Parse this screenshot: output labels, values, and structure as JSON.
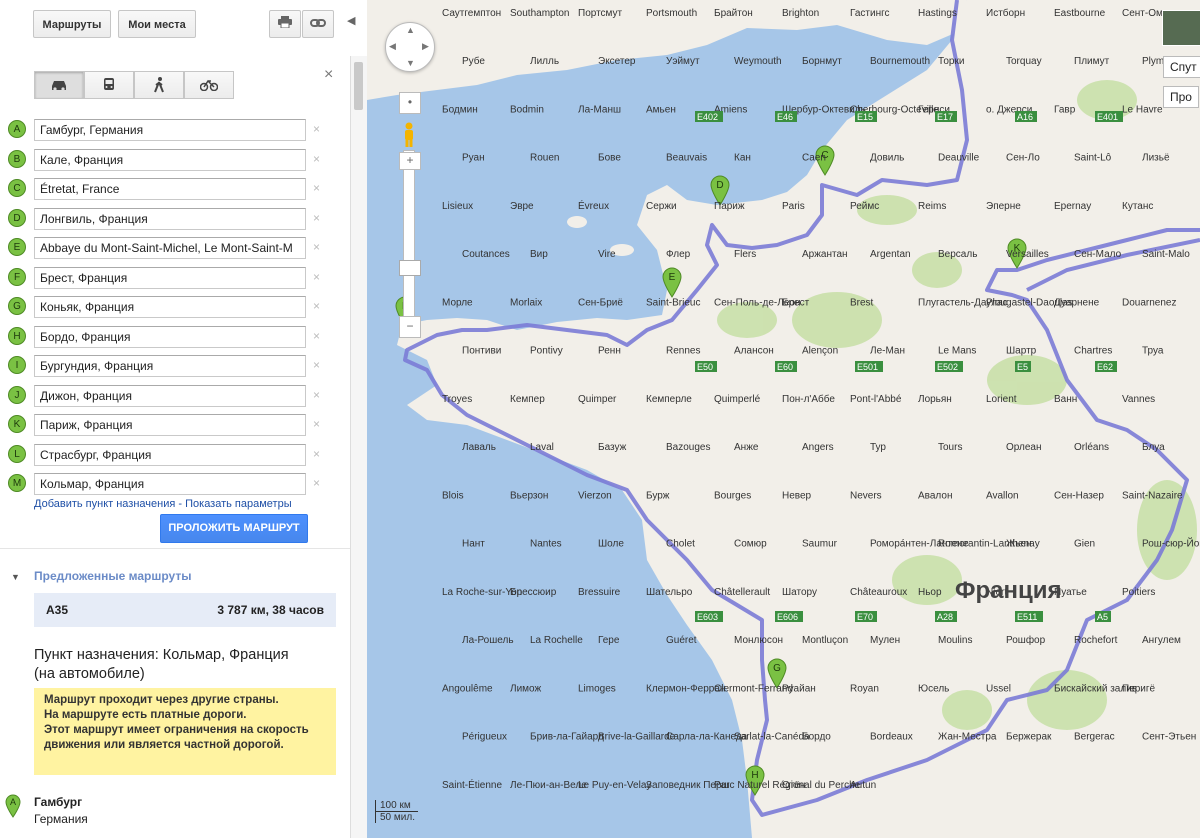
{
  "toolbar": {
    "routes_tab": "Маршруты",
    "my_places_tab": "Мои места",
    "print_icon": "printer-icon",
    "link_icon": "link-icon"
  },
  "travel_modes": [
    {
      "name": "car",
      "icon": "car-icon",
      "active": true
    },
    {
      "name": "transit",
      "icon": "bus-icon",
      "active": false
    },
    {
      "name": "walking",
      "icon": "walking-icon",
      "active": false
    },
    {
      "name": "bicycle",
      "icon": "bicycle-icon",
      "active": false
    }
  ],
  "waypoints": [
    {
      "letter": "A",
      "value": "Гамбург, Германия"
    },
    {
      "letter": "B",
      "value": "Кале, Франция"
    },
    {
      "letter": "C",
      "value": "Étretat, France"
    },
    {
      "letter": "D",
      "value": "Лонгвиль, Франция"
    },
    {
      "letter": "E",
      "value": "Abbaye du Mont-Saint-Michel, Le Mont-Saint-M"
    },
    {
      "letter": "F",
      "value": "Брест, Франция"
    },
    {
      "letter": "G",
      "value": "Коньяк, Франция"
    },
    {
      "letter": "H",
      "value": "Бордо, Франция"
    },
    {
      "letter": "I",
      "value": "Бургундия, Франция"
    },
    {
      "letter": "J",
      "value": "Дижон, Франция"
    },
    {
      "letter": "K",
      "value": "Париж, Франция"
    },
    {
      "letter": "L",
      "value": "Страсбург, Франция"
    },
    {
      "letter": "M",
      "value": "Кольмар, Франция"
    }
  ],
  "add_destination": "Добавить пункт назначения",
  "separator": " - ",
  "show_options": "Показать параметры",
  "route_button": "ПРОЛОЖИТЬ МАРШРУТ",
  "suggested_routes": {
    "title": "Предложенные маршруты",
    "items": [
      {
        "name": "A35",
        "summary": "3 787 км, 38 часов"
      }
    ]
  },
  "destination": {
    "title": "Пункт назначения: Кольмар, Франция",
    "subtitle": "(на автомобиле)"
  },
  "warnings": [
    "Маршрут проходит через другие страны.",
    "На маршруте есть платные дороги.",
    "Этот маршрут имеет ограничения на скорость движения или является частной дорогой."
  ],
  "start": {
    "letter": "A",
    "city": "Гамбург",
    "country": "Германия"
  },
  "map": {
    "country_label": "Франция",
    "satellite_label": "Спут",
    "more_label": "Про",
    "scale_km": "100 км",
    "scale_mi": "50 мил.",
    "route_color": "#7b7bd6",
    "water_color": "#a6c6e8",
    "land_color": "#f2efe9",
    "forest_color": "#c7dfa6",
    "marker_color": "#7ac143",
    "cities": [
      "Саутгемптон",
      "Southampton",
      "Портсмут",
      "Portsmouth",
      "Брайтон",
      "Brighton",
      "Гастингс",
      "Hastings",
      "Истборн",
      "Eastbourne",
      "Сент-Омер",
      "Рубе",
      "Лилль",
      "Эксетер",
      "Уэймут",
      "Weymouth",
      "Борнмут",
      "Bournemouth",
      "Торки",
      "Torquay",
      "Плимут",
      "Plymouth",
      "Бодмин",
      "Bodmin",
      "Ла-Манш",
      "Амьен",
      "Amiens",
      "Шербур-Октевиль",
      "Cherbourg-Octeville",
      "Гернси",
      "о. Джерси",
      "Гавр",
      "Le Havre",
      "Руан",
      "Rouen",
      "Бове",
      "Beauvais",
      "Кан",
      "Caen",
      "Довиль",
      "Deauville",
      "Сен-Ло",
      "Saint-Lô",
      "Лизьё",
      "Lisieux",
      "Эвре",
      "Évreux",
      "Сержи",
      "Париж",
      "Paris",
      "Реймс",
      "Reims",
      "Эперне",
      "Epernay",
      "Кутанс",
      "Coutances",
      "Вир",
      "Vire",
      "Флер",
      "Flers",
      "Аржантан",
      "Argentan",
      "Версаль",
      "Versailles",
      "Сен-Мало",
      "Saint-Malo",
      "Морле",
      "Morlaix",
      "Сен-Бриё",
      "Saint-Brieuc",
      "Сен-Поль-де-Леон",
      "Брест",
      "Brest",
      "Плугастель-Даулас",
      "Plougastel-Daoulas",
      "Дуарнене",
      "Douarnenez",
      "Понтиви",
      "Pontivy",
      "Ренн",
      "Rennes",
      "Алансон",
      "Alençon",
      "Ле-Ман",
      "Le Mans",
      "Шартр",
      "Chartres",
      "Труа",
      "Troyes",
      "Кемпер",
      "Quimper",
      "Кемперле",
      "Quimperlé",
      "Пон-л'Аббе",
      "Pont-l'Abbé",
      "Лорьян",
      "Lorient",
      "Ванн",
      "Vannes",
      "Лаваль",
      "Laval",
      "Базуж",
      "Bazouges",
      "Анже",
      "Angers",
      "Тур",
      "Tours",
      "Орлеан",
      "Orléans",
      "Блуа",
      "Blois",
      "Вьерзон",
      "Vierzon",
      "Бурж",
      "Bourges",
      "Невер",
      "Nevers",
      "Авалон",
      "Avallon",
      "Сен-Назер",
      "Saint-Nazaire",
      "Нант",
      "Nantes",
      "Шоле",
      "Cholet",
      "Сомюр",
      "Saumur",
      "Ромора́нтен-Лантене",
      "Romorantin-Lanthenay",
      "Жьен",
      "Gien",
      "Рош-сюр-Йон",
      "La Roche-sur-Yon",
      "Брессюир",
      "Bressuire",
      "Шательро",
      "Châtellerault",
      "Шатору",
      "Châteauroux",
      "Ньор",
      "Niort",
      "Пуатье",
      "Poitiers",
      "Ла-Рошель",
      "La Rochelle",
      "Гере",
      "Guéret",
      "Монлюсон",
      "Montluçon",
      "Мулен",
      "Moulins",
      "Рошфор",
      "Rochefort",
      "Ангулем",
      "Angoulême",
      "Лимож",
      "Limoges",
      "Клермон-Ферран",
      "Clermont-Ferrand",
      "Руайан",
      "Royan",
      "Юсель",
      "Ussel",
      "Бискайский залив",
      "Перигё",
      "Périgueux",
      "Брив-ла-Гайард",
      "Brive-la-Gaillarde",
      "Сарла-ла-Канеда",
      "Sarlat-la-Canéda",
      "Бордо",
      "Bordeaux",
      "Жан-Местра",
      "Бержерак",
      "Bergerac",
      "Сент-Этьен",
      "Saint-Étienne",
      "Ле-Пюи-ан-Веле",
      "Le Puy-en-Velay",
      "Заповедник Перш",
      "Parc Naturel Régional du Perche",
      "Отён",
      "Autun"
    ],
    "road_labels": [
      "E402",
      "E46",
      "E15",
      "E17",
      "A16",
      "E401",
      "E50",
      "E60",
      "E501",
      "E502",
      "E5",
      "E62",
      "E603",
      "E606",
      "E70",
      "A28",
      "E511",
      "A5"
    ]
  }
}
